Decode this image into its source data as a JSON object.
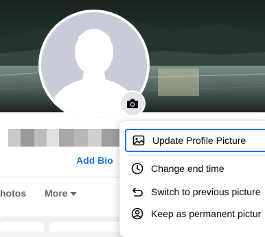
{
  "profile": {
    "add_bio_label": "Add Bio",
    "accent_color": "#1b74e4"
  },
  "tabs": {
    "photos_label": "hotos",
    "more_label": "More"
  },
  "menu": {
    "items": [
      {
        "label": "Update Profile Picture",
        "icon": "image-icon"
      },
      {
        "label": "Change end time",
        "icon": "clock-icon"
      },
      {
        "label": "Switch to previous picture",
        "icon": "undo-icon"
      },
      {
        "label": "Keep as permanent pictur",
        "icon": "user-circle-icon"
      }
    ]
  }
}
